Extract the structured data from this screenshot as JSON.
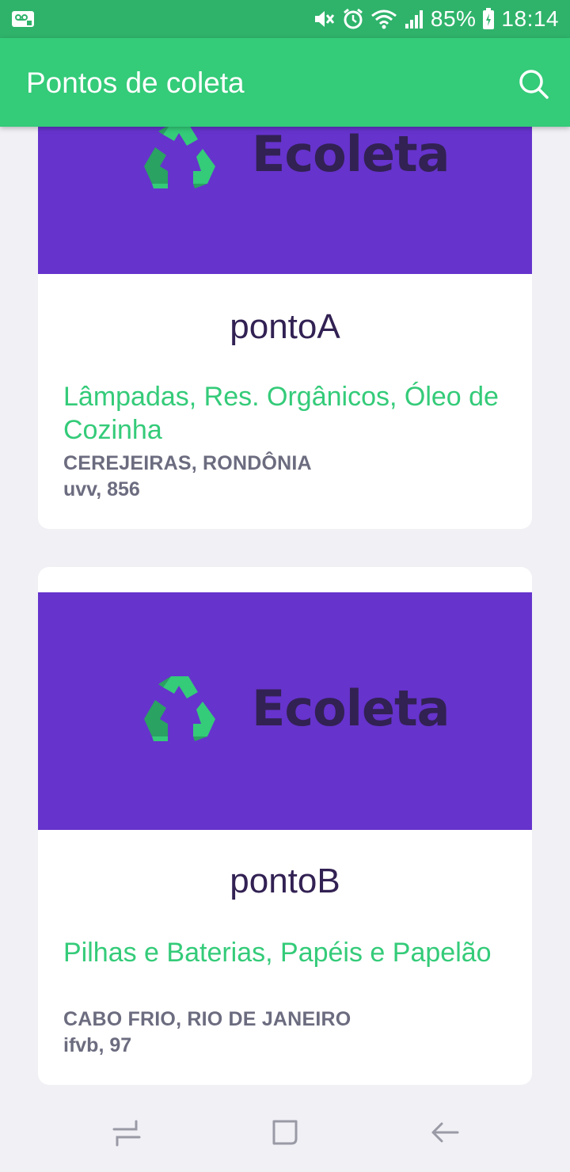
{
  "status_bar": {
    "battery": "85%",
    "time": "18:14",
    "icons": [
      "voicemail-icon",
      "mute-icon",
      "alarm-icon",
      "wifi-icon",
      "signal-icon",
      "battery-charging-icon"
    ]
  },
  "app_bar": {
    "title": "Pontos de coleta",
    "search_icon": "search-icon"
  },
  "points": [
    {
      "brand": "Ecoleta",
      "name": "pontoA",
      "items": "Lâmpadas, Res. Orgânicos, Óleo de Cozinha",
      "city": "CEREJEIRAS, RONDÔNIA",
      "address": "uvv, 856"
    },
    {
      "brand": "Ecoleta",
      "name": "pontoB",
      "items": "Pilhas e Baterias, Papéis e Papelão",
      "city": "CABO FRIO, RIO DE JANEIRO",
      "address": "ifvb, 97"
    }
  ],
  "nav_bar": {
    "buttons": [
      "recents-icon",
      "home-icon",
      "back-icon"
    ]
  },
  "colors": {
    "status_bar": "#2fb36b",
    "app_bar": "#34cb79",
    "banner": "#6633cc",
    "brand_text": "#322153",
    "items_text": "#34cb79",
    "meta_text": "#6c6c80",
    "background": "#f0f0f5"
  }
}
